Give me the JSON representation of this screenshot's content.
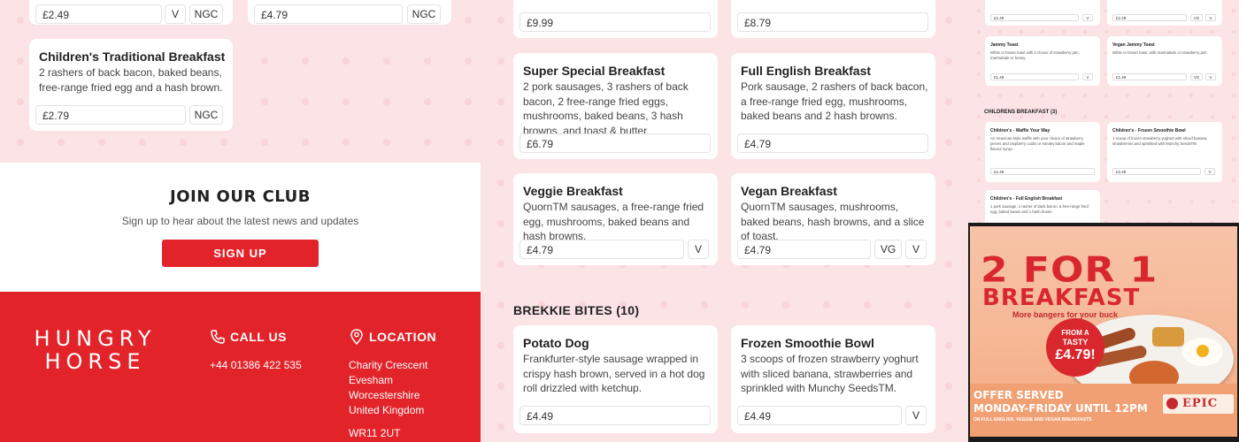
{
  "left": {
    "top_cards": [
      {
        "price": "£2.49",
        "tags": [
          "V",
          "NGC"
        ]
      },
      {
        "price": "£4.79",
        "tags": [
          "NGC"
        ]
      }
    ],
    "children_card": {
      "title": "Children's Traditional Breakfast",
      "desc": "2 rashers of back bacon, baked beans, free-range fried egg and a hash brown.",
      "price": "£2.79",
      "tag": "NGC"
    },
    "club": {
      "title": "JOIN OUR CLUB",
      "subtitle": "Sign up to hear about the latest news and updates",
      "button": "SIGN UP"
    },
    "footer": {
      "logo_line1": "HUNGRY",
      "logo_line2": "HORSE",
      "call_title": "CALL US",
      "phone": "+44 01386 422 535",
      "location_title": "LOCATION",
      "address": [
        "Charity Crescent",
        "Evesham",
        "Worcestershire",
        "United Kingdom"
      ],
      "postcode": "WR11 2UT"
    }
  },
  "middle": {
    "top_prices": [
      "£9.99",
      "£8.79"
    ],
    "cards": [
      {
        "title": "Super Special Breakfast",
        "desc": "2 pork sausages, 3 rashers of back bacon, 2 free-range fried eggs, mushrooms, baked beans, 3 hash browns, and toast & butter.",
        "price": "£6.79",
        "tags": []
      },
      {
        "title": "Full English Breakfast",
        "desc": "Pork sausage, 2 rashers of back bacon, a free-range fried egg, mushrooms, baked beans and 2 hash browns.",
        "price": "£4.79",
        "tags": []
      },
      {
        "title": "Veggie Breakfast",
        "desc": "QuornTM sausages, a free-range fried egg, mushrooms, baked beans and hash browns.",
        "price": "£4.79",
        "tags": [
          "V"
        ]
      },
      {
        "title": "Vegan Breakfast",
        "desc": "QuornTM sausages, mushrooms, baked beans, hash browns, and a slice of toast.",
        "price": "£4.79",
        "tags": [
          "VG",
          "V"
        ]
      }
    ],
    "section_title": "BREKKIE BITES (10)",
    "bites": [
      {
        "title": "Potato Dog",
        "desc": "Frankfurter-style sausage wrapped in crispy hash brown, served in a hot dog roll drizzled with ketchup.",
        "price": "£4.49",
        "tags": []
      },
      {
        "title": "Frozen Smoothie Bowl",
        "desc": "3 scoops of frozen strawberry yoghurt with sliced banana, strawberries and sprinkled with Munchy SeedsTM.",
        "price": "£4.49",
        "tags": [
          "V"
        ]
      }
    ]
  },
  "right": {
    "top_text": "toast.",
    "row1": [
      {
        "price": "£2.49",
        "tags": [
          "V"
        ]
      },
      {
        "price": "£2.29",
        "tags": [
          "VG",
          "V"
        ]
      }
    ],
    "row2": [
      {
        "title": "Jammy Toast",
        "desc": "White or brown toast with a choice of strawberry jam, marmalade or honey.",
        "price": "£1.49",
        "tags": [
          "V"
        ]
      },
      {
        "title": "Vegan Jammy Toast",
        "desc": "White or brown toast, with marmalade or strawberry jam.",
        "price": "£1.49",
        "tags": [
          "VG",
          "V"
        ]
      }
    ],
    "section_title": "CHILDRENS BREAKFAST (3)",
    "row3": [
      {
        "title": "Children's - Waffle Your Way",
        "desc": "An American-style waffle with your choice of strawberry pieces and raspberry coulis or streaky bacon and maple flavour syrup.",
        "price": "£2.49",
        "tags": []
      },
      {
        "title": "Children's - Frozen Smoothie Bowl",
        "desc": "1 scoop of frozen strawberry yoghurt with sliced banana, strawberries and sprinkled with Munchy SeedsTM.",
        "price": "£2.49",
        "tags": [
          "V"
        ]
      }
    ],
    "row4": {
      "title": "Children's - Full English Breakfast",
      "desc": "1 pork sausage, 1 rasher of back bacon, a free-range fried egg, baked beans and 1 hash brown."
    }
  },
  "poster": {
    "headline": "2 FOR 1",
    "subheadline": "BREAKFAST",
    "tagline": "More bangers for your buck",
    "badge_line1": "FROM A",
    "badge_line2": "TASTY",
    "badge_price": "£4.79!",
    "offer_line": "OFFER SERVED",
    "offer_line2": "MONDAY-FRIDAY UNTIL 12PM",
    "offer_small": "ON FULL ENGLISH, VEGGIE AND VEGAN BREAKFASTS",
    "brand": "EPIC"
  }
}
